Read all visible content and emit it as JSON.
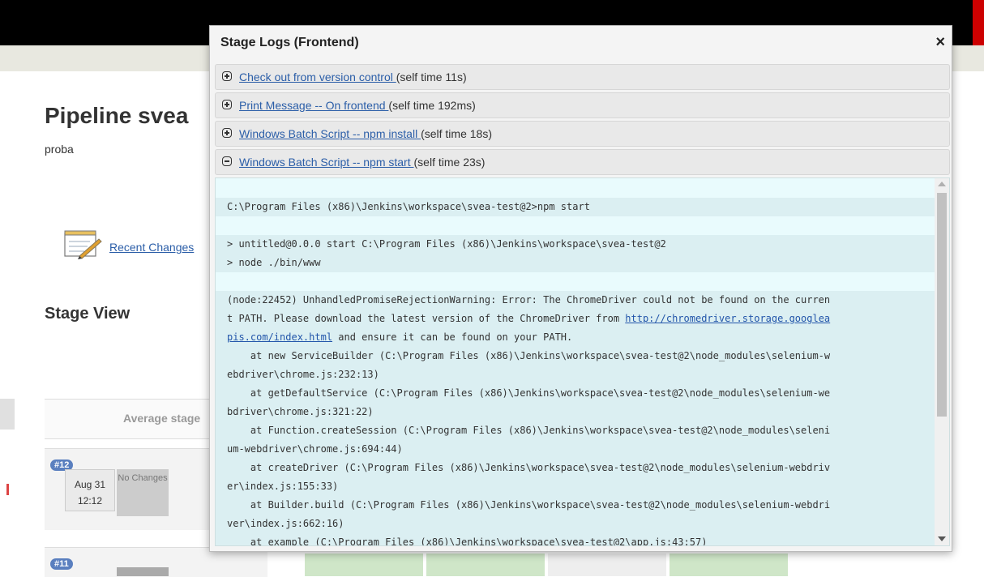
{
  "background": {
    "page_title": "Pipeline svea",
    "description": "proba",
    "recent_changes_label": "Recent Changes",
    "stage_view_title": "Stage View",
    "average_label": "Average stage",
    "builds": [
      {
        "number": "#12",
        "date": "Aug 31",
        "time": "12:12",
        "changes": "No Changes"
      },
      {
        "number": "#11"
      }
    ]
  },
  "modal": {
    "title": "Stage Logs (Frontend)",
    "close_icon": "×",
    "steps": [
      {
        "label": "Check out from version control ",
        "self_time": "(self time 11s)",
        "expanded": false
      },
      {
        "label": "Print Message -- On frontend ",
        "self_time": "(self time 192ms)",
        "expanded": false
      },
      {
        "label": "Windows Batch Script -- npm install ",
        "self_time": "(self time 18s)",
        "expanded": false
      },
      {
        "label": "Windows Batch Script -- npm start ",
        "self_time": "(self time 23s)",
        "expanded": true
      }
    ],
    "log_lines": [
      "",
      "C:\\Program Files (x86)\\Jenkins\\workspace\\svea-test@2>npm start",
      "",
      "> untitled@0.0.0 start C:\\Program Files (x86)\\Jenkins\\workspace\\svea-test@2",
      "> node ./bin/www",
      "",
      "(node:22452) UnhandledPromiseRejectionWarning: Error: The ChromeDriver could not be found on the curren",
      "t PATH. Please download the latest version of the ChromeDriver from ",
      "pis.com/index.html",
      "    at new ServiceBuilder (C:\\Program Files (x86)\\Jenkins\\workspace\\svea-test@2\\node_modules\\selenium-w",
      "ebdriver\\chrome.js:232:13)",
      "    at getDefaultService (C:\\Program Files (x86)\\Jenkins\\workspace\\svea-test@2\\node_modules\\selenium-we",
      "bdriver\\chrome.js:321:22)",
      "    at Function.createSession (C:\\Program Files (x86)\\Jenkins\\workspace\\svea-test@2\\node_modules\\seleni",
      "um-webdriver\\chrome.js:694:44)",
      "    at createDriver (C:\\Program Files (x86)\\Jenkins\\workspace\\svea-test@2\\node_modules\\selenium-webdriv",
      "er\\index.js:155:33)",
      "    at Builder.build (C:\\Program Files (x86)\\Jenkins\\workspace\\svea-test@2\\node_modules\\selenium-webdri",
      "ver\\index.js:662:16)",
      "    at example (C:\\Program Files (x86)\\Jenkins\\workspace\\svea-test@2\\app.js:43:57)"
    ],
    "log_url_part1": "http://chromedriver.storage.googlea",
    "log_url_part2": "pis.com/index.html",
    "log_line8_rest": " and ensure it can be found on your PATH."
  },
  "colors": {
    "link": "#2b5ea8",
    "log_bg": "#e9fbfd",
    "log_stripe": "#dbeff2",
    "success_cell": "#cfe6c8"
  }
}
